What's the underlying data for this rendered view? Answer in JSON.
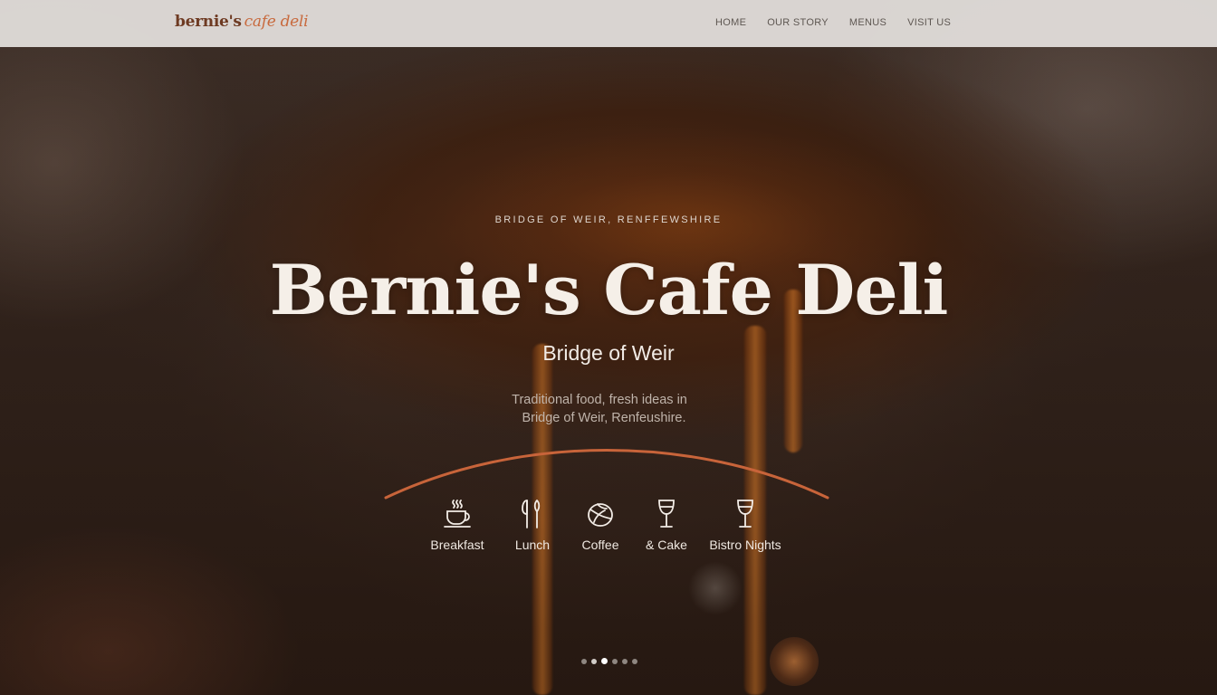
{
  "header": {
    "logo_main": "bernie's",
    "logo_accent": "cafe deli",
    "nav": [
      {
        "label": "HOME"
      },
      {
        "label": "OUR STORY"
      },
      {
        "label": "MENUS"
      },
      {
        "label": "VISIT US"
      }
    ]
  },
  "hero": {
    "eyebrow": "BRIDGE OF WEIR, RENFFEWSHIRE",
    "title": "Bernie's Cafe Deli",
    "subtitle": "Bridge of Weir",
    "tagline_line1": "Traditional food, fresh ideas in",
    "tagline_line2": "Bridge of Weir, Renfeushire.",
    "services": [
      {
        "label": "Breakfast",
        "icon": "coffee-cup-icon"
      },
      {
        "label": "Lunch",
        "icon": "cutlery-icon"
      },
      {
        "label": "Coffee",
        "icon": "coffee-bean-icon"
      },
      {
        "label": "& Cake",
        "icon": "wine-glass-icon"
      },
      {
        "label": "Bistro Nights",
        "icon": "wine-glass-icon"
      }
    ],
    "carousel": {
      "slide_count": 6,
      "active_index": 2
    }
  },
  "colors": {
    "accent": "#c8643a",
    "logo_brown": "#6e3a22",
    "header_bg": "#e0dcd8",
    "title_text": "#f5efe8"
  }
}
